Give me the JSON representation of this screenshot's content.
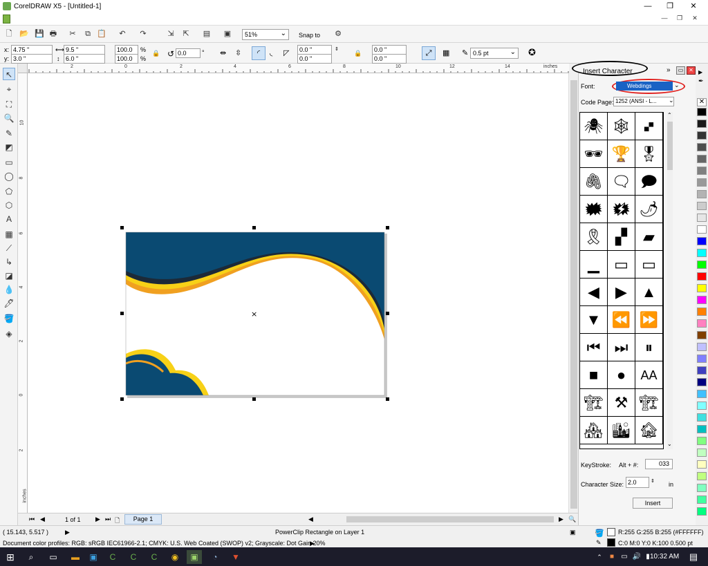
{
  "window": {
    "title": "CorelDRAW X5 - [Untitled-1]",
    "minimize": "—",
    "maximize": "❐",
    "close": "✕"
  },
  "toolbar": {
    "zoom": "51%",
    "snap_to": "Snap to"
  },
  "props": {
    "x": "4.75 \"",
    "y": "3.0 \"",
    "width": "9.5 \"",
    "height": "6.0 \"",
    "scale_w": "100.0",
    "scale_h": "100.0",
    "pct": "%",
    "angle": "0.0",
    "deg": "°",
    "corner1": "0.0 \"",
    "corner2": "0.0 \"",
    "corner3": "0.0 \"",
    "corner4": "0.0 \"",
    "outline": "0.5 pt"
  },
  "ruler": {
    "h": [
      "2",
      "0",
      "2",
      "4",
      "6",
      "8",
      "10",
      "12",
      "14",
      "inches"
    ],
    "v": [
      "10",
      "8",
      "6",
      "4",
      "2",
      "0",
      "2"
    ],
    "unit": "inches"
  },
  "docker": {
    "title": "Insert Character",
    "font_label": "Font:",
    "font_value": "Webdings",
    "codepage_label": "Code Page:",
    "codepage_value": "1252  (ANSI - L...",
    "glyphs": [
      "🕷",
      "🕸",
      "🙾",
      "🕶",
      "🏆",
      "🎖",
      "🖇",
      "🗨",
      "🗩",
      "🗰",
      "🗱",
      "🌶",
      "🎗",
      "▞",
      "▰",
      "▁",
      "▭",
      "▭",
      "◀",
      "▶",
      "▲",
      "▼",
      "⏪",
      "⏩",
      "⏮",
      "⏭",
      "⏸",
      "■",
      "●",
      "AA",
      "🏗",
      "⚒",
      "🏗",
      "🏘",
      "🏙",
      "🏚"
    ],
    "keystroke_label": "KeyStroke:",
    "keystroke_mod": "Alt + #:",
    "keystroke_value": "033",
    "charsize_label": "Character Size:",
    "charsize_value": "2.0",
    "charsize_unit": "in",
    "insert_label": "Insert"
  },
  "nav": {
    "page_count": "1 of 1",
    "page_tab": "Page 1"
  },
  "status": {
    "coords": "( 15.143, 5.517 )",
    "object": "PowerClip Rectangle on Layer 1",
    "profiles": "Document color profiles: RGB: sRGB IEC61966-2.1; CMYK: U.S. Web Coated (SWOP) v2; Grayscale: Dot Gain 20%",
    "fill": "R:255 G:255 B:255 (#FFFFFF)",
    "outline": "C:0 M:0 Y:0 K:100  0.500 pt"
  },
  "taskbar": {
    "time": "10:32 AM"
  },
  "colors": {
    "navy": "#0a4a72",
    "yellow": "#f7d117",
    "orange": "#f0a020",
    "dark": "#1c2a38"
  },
  "palette": [
    "#000000",
    "#1a1a1a",
    "#333333",
    "#4d4d4d",
    "#666666",
    "#808080",
    "#999999",
    "#b3b3b3",
    "#cccccc",
    "#e6e6e6",
    "#ffffff",
    "#0000ff",
    "#00ffff",
    "#00ff00",
    "#ff0000",
    "#ffff00",
    "#ff00ff",
    "#ff8000",
    "#ff80c0",
    "#804000",
    "#c0c0ff",
    "#8080ff",
    "#4040c0",
    "#000080",
    "#40c0ff",
    "#80ffff",
    "#40e0e0",
    "#00c0c0",
    "#80ff80",
    "#c0ffc0",
    "#ffffc0",
    "#c0ff80",
    "#80ffc0",
    "#40ffa0",
    "#00ff80"
  ]
}
